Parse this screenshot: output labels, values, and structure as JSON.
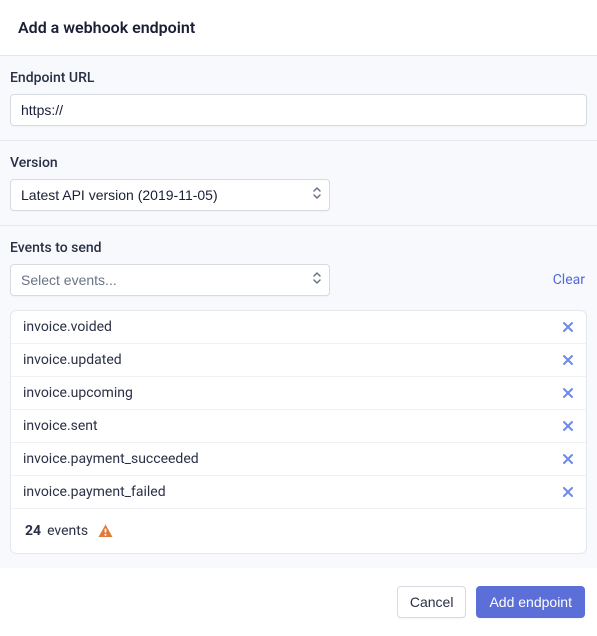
{
  "header": {
    "title": "Add a webhook endpoint"
  },
  "endpoint": {
    "label": "Endpoint URL",
    "value": "https://"
  },
  "version": {
    "label": "Version",
    "selected": "Latest API version (2019-11-05)"
  },
  "events": {
    "label": "Events to send",
    "placeholder": "Select events...",
    "clear": "Clear",
    "items": [
      "invoice.voided",
      "invoice.updated",
      "invoice.upcoming",
      "invoice.sent",
      "invoice.payment_succeeded",
      "invoice.payment_failed"
    ],
    "summary_count": "24",
    "summary_label": "events"
  },
  "footer": {
    "cancel": "Cancel",
    "submit": "Add endpoint"
  }
}
